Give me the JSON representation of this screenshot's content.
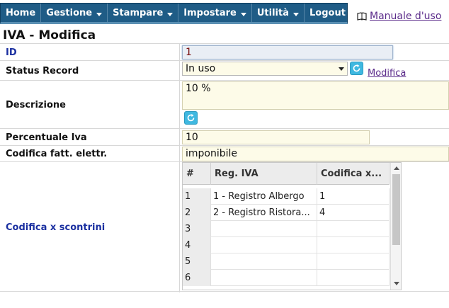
{
  "nav": {
    "items": [
      {
        "label": "Home",
        "dropdown": false
      },
      {
        "label": "Gestione",
        "dropdown": true
      },
      {
        "label": "Stampare",
        "dropdown": true
      },
      {
        "label": "Impostare",
        "dropdown": true
      },
      {
        "label": "Utilità",
        "dropdown": true
      },
      {
        "label": "Logout",
        "dropdown": false
      }
    ],
    "manual_label": "Manuale d'uso",
    "manual_icon": "book-icon"
  },
  "page_title": "IVA - Modifica",
  "form": {
    "id": {
      "label": "ID",
      "value": "1"
    },
    "status": {
      "label": "Status Record",
      "value": "In uso",
      "modifica_label": "Modifica"
    },
    "descrizione": {
      "label": "Descrizione",
      "value": "10 %"
    },
    "percentuale": {
      "label": "Percentuale Iva",
      "value": "10"
    },
    "codifica_fatt": {
      "label": "Codifica fatt. elettr.",
      "value": "imponibile"
    },
    "codifica_scontrini": {
      "label": "Codifica x scontrini"
    }
  },
  "grid": {
    "columns": [
      "#",
      "Reg. IVA",
      "Codifica x..."
    ],
    "rows": [
      [
        "1",
        "1 - Registro Albergo",
        "1"
      ],
      [
        "2",
        "2 - Registro Ristora...",
        "4"
      ],
      [
        "3",
        "",
        ""
      ],
      [
        "4",
        "",
        ""
      ],
      [
        "5",
        "",
        ""
      ],
      [
        "6",
        "",
        ""
      ]
    ]
  },
  "colors": {
    "nav_bg": "#1f5c86",
    "field_bg": "#fdfbe8",
    "label_blue": "#1a2fa0",
    "refresh": "#3fb8e0"
  }
}
